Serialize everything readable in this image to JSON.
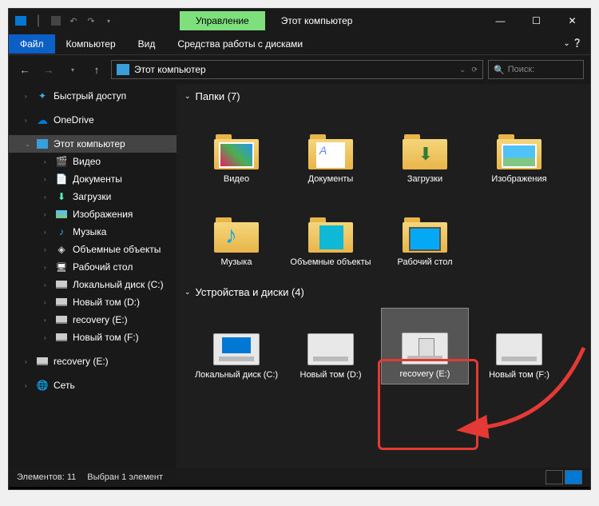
{
  "titlebar": {
    "contextual_tab": "Управление",
    "title": "Этот компьютер",
    "min": "—",
    "max": "☐",
    "close": "✕"
  },
  "ribbon": {
    "file": "Файл",
    "computer": "Компьютер",
    "view": "Вид",
    "drive_tools": "Средства работы с дисками",
    "expand": "⌄"
  },
  "nav": {
    "back": "←",
    "forward": "→",
    "up": "↑",
    "crumb": "Этот компьютер",
    "refresh": "⟳",
    "search_icon": "🔍",
    "search_ph": "Поиск:"
  },
  "sidebar": {
    "quick": "Быстрый доступ",
    "onedrive": "OneDrive",
    "thispc": "Этот компьютер",
    "children": {
      "video": "Видео",
      "documents": "Документы",
      "downloads": "Загрузки",
      "pictures": "Изображения",
      "music": "Музыка",
      "objects3d": "Объемные объекты",
      "desktop": "Рабочий стол",
      "diskC": "Локальный диск (C:)",
      "diskD": "Новый том (D:)",
      "recoveryE": "recovery (E:)",
      "diskF": "Новый том (F:)"
    },
    "recoveryE2": "recovery (E:)",
    "network": "Сеть"
  },
  "sections": {
    "folders": "Папки (7)",
    "devices": "Устройства и диски (4)"
  },
  "folders": {
    "video": "Видео",
    "documents": "Документы",
    "downloads": "Загрузки",
    "pictures": "Изображения",
    "music": "Музыка",
    "objects3d": "Объемные объекты",
    "desktop": "Рабочий стол"
  },
  "drives": {
    "c": "Локальный диск (C:)",
    "d": "Новый том (D:)",
    "e": "recovery (E:)",
    "f": "Новый том (F:)"
  },
  "status": {
    "count": "Элементов: 11",
    "selected": "Выбран 1 элемент"
  }
}
